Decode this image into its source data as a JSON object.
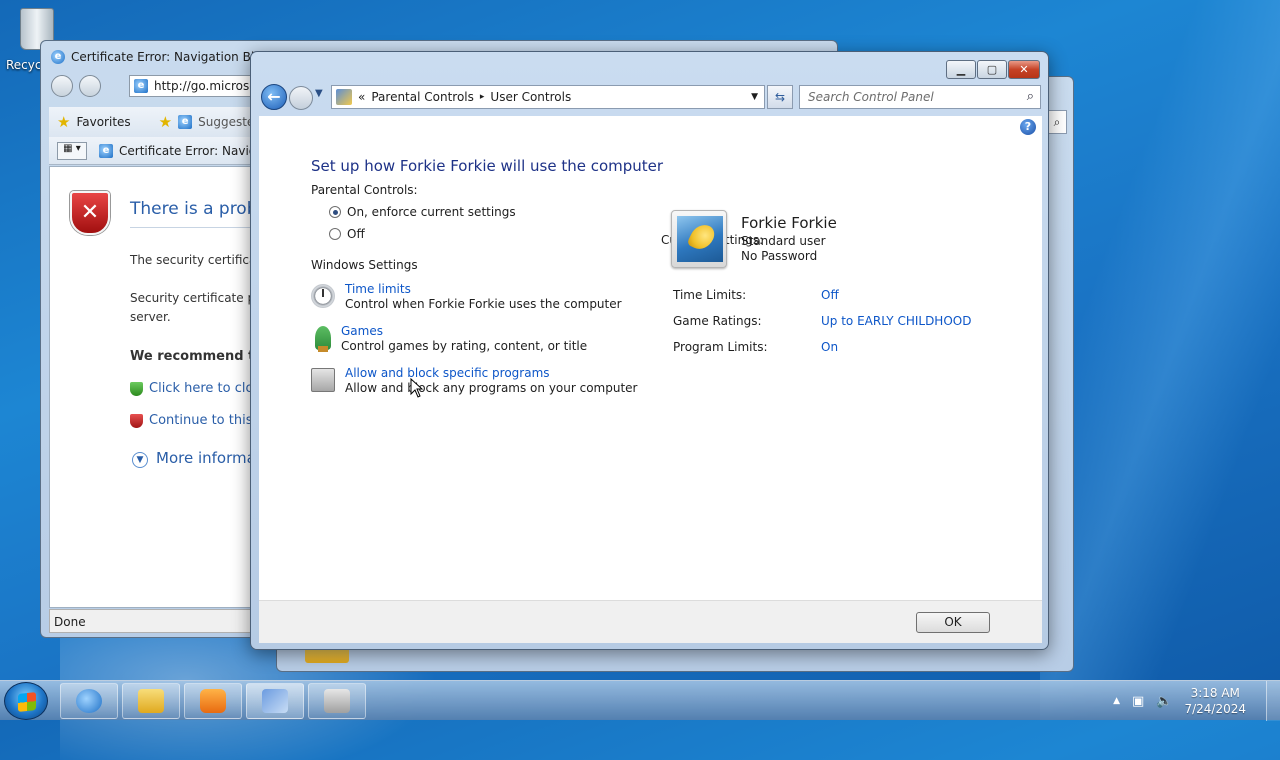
{
  "desktop": {
    "recycle_label": "Recyc"
  },
  "ie": {
    "title": "Certificate Error: Navigation Blocke",
    "address": "http://go.microsoft",
    "favorites_label": "Favorites",
    "suggested_label": "Suggested S",
    "tab_label": "Certificate Error: Navigati",
    "heading": "There is a probl",
    "line1": "The security certifica",
    "line2a": "Security certificate p",
    "line2b": "server.",
    "recommend": "We recommend th",
    "link_close": "Click here to clos",
    "link_continue": "Continue to this",
    "more_info": "More informa",
    "status": "Done"
  },
  "pc": {
    "breadcrumb": {
      "chevrons": "«",
      "item1": "Parental Controls",
      "sep": "▸",
      "item2": "User Controls"
    },
    "search_placeholder": "Search Control Panel",
    "heading": "Set up how Forkie Forkie will use the computer",
    "parental_controls_label": "Parental Controls:",
    "radio_on": "On, enforce current settings",
    "radio_off": "Off",
    "windows_settings_label": "Windows Settings",
    "settings": [
      {
        "title": "Time limits",
        "desc": "Control when Forkie Forkie uses the computer",
        "icon": "clock-icon"
      },
      {
        "title": "Games",
        "desc": "Control games by rating, content, or title",
        "icon": "trophy-icon"
      },
      {
        "title": "Allow and block specific programs",
        "desc": "Allow and block any programs on your computer",
        "icon": "program-icon"
      }
    ],
    "current_settings_label": "Current Settings:",
    "user": {
      "name": "Forkie Forkie",
      "type": "Standard user",
      "password": "No Password"
    },
    "summary": [
      {
        "label": "Time Limits:",
        "value": "Off"
      },
      {
        "label": "Game Ratings:",
        "value": "Up to EARLY CHILDHOOD"
      },
      {
        "label": "Program Limits:",
        "value": "On"
      }
    ],
    "ok_label": "OK"
  },
  "taskbar": {
    "time": "3:18 AM",
    "date": "7/24/2024"
  },
  "colors": {
    "link": "#0d56c8",
    "heading": "#1e3287"
  }
}
